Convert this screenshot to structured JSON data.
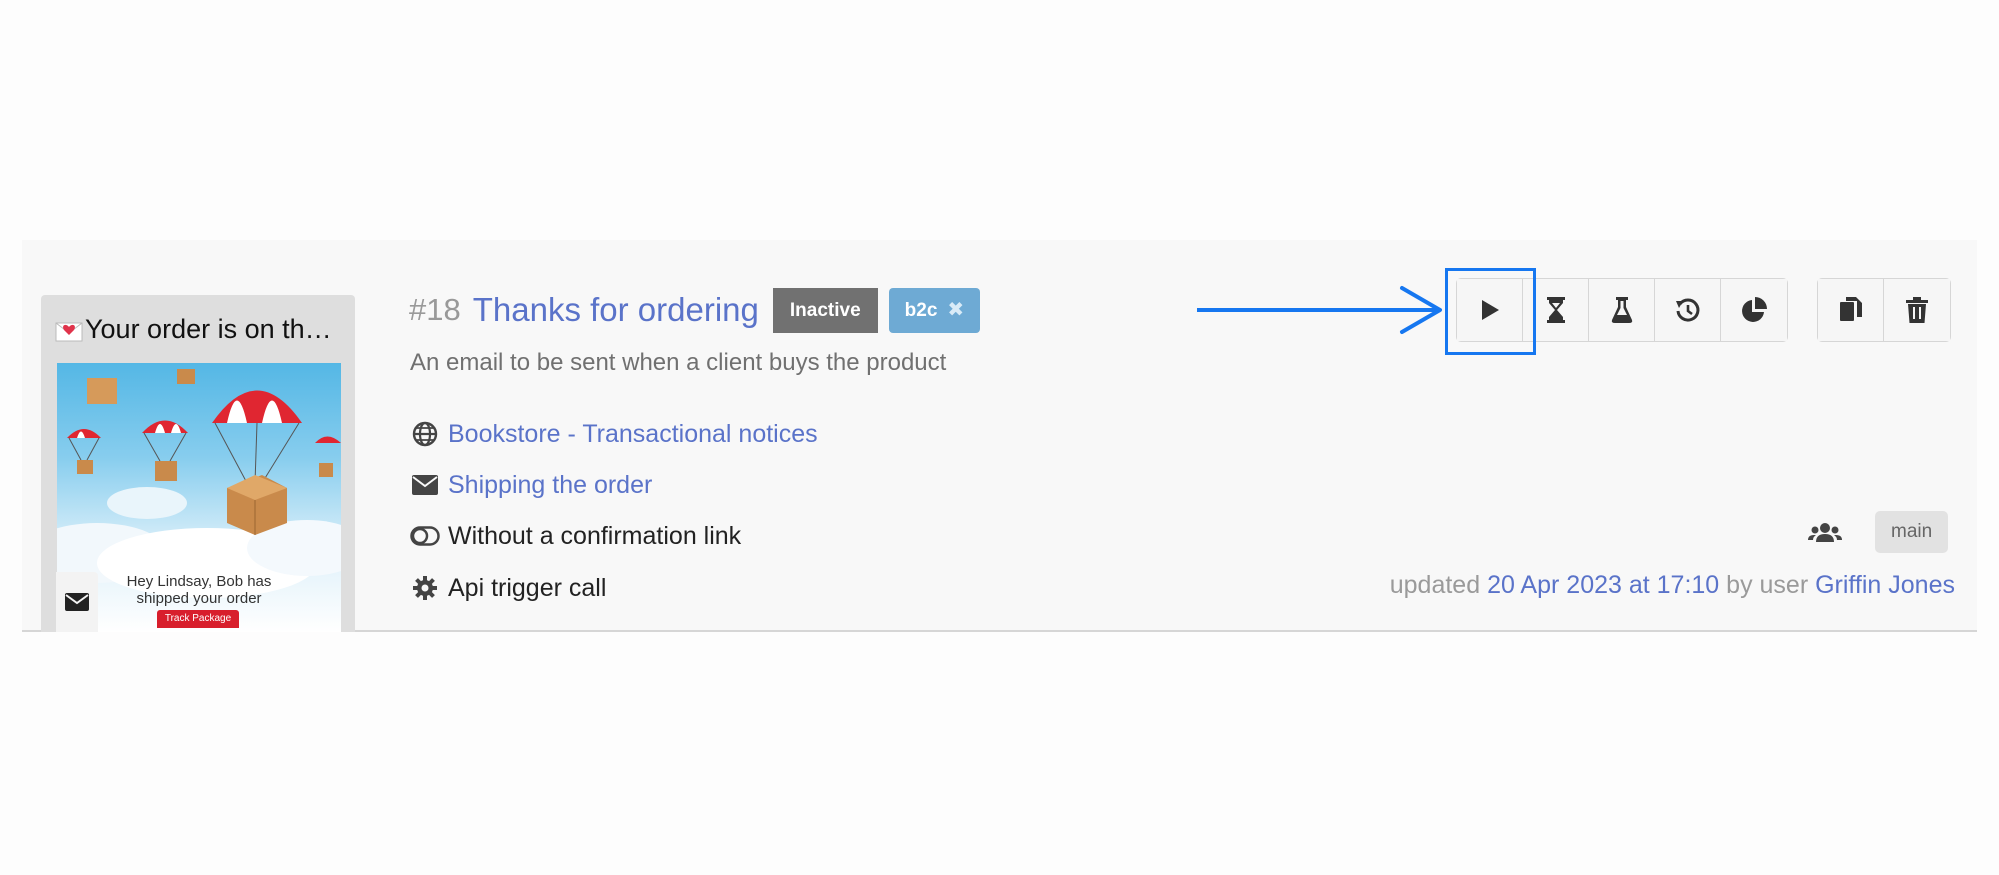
{
  "campaign": {
    "id": "#18",
    "name": "Thanks for ordering",
    "status_badge": "Inactive",
    "tag": "b2c",
    "description": "An email to be sent when a client buys the product",
    "site": "Bookstore - Transactional notices",
    "template": "Shipping the order",
    "confirmation": "Without a confirmation link",
    "trigger": "Api trigger call",
    "branch": "main",
    "updated": {
      "prefix": "updated",
      "date": "20 Apr 2023 at 17:10",
      "by": "by user",
      "user": "Griffin Jones"
    }
  },
  "thumbnail": {
    "subject": "Your order is on the…",
    "body_text": "Hey Lindsay, Bob has shipped your order",
    "button_label": "Track Package"
  },
  "icons": {
    "site": "globe-icon",
    "template": "envelope-icon",
    "confirmation": "toggle-icon",
    "trigger": "gear-icon",
    "users": "users-icon",
    "type": "envelope-icon"
  },
  "actions": [
    "play-icon",
    "hourglass-icon",
    "flask-icon",
    "history-icon",
    "pie-chart-icon",
    "copy-icon",
    "trash-icon"
  ],
  "colors": {
    "link": "#5a73c9",
    "inactive": "#717171",
    "tag": "#6eaad4",
    "highlight": "#1677f0"
  }
}
